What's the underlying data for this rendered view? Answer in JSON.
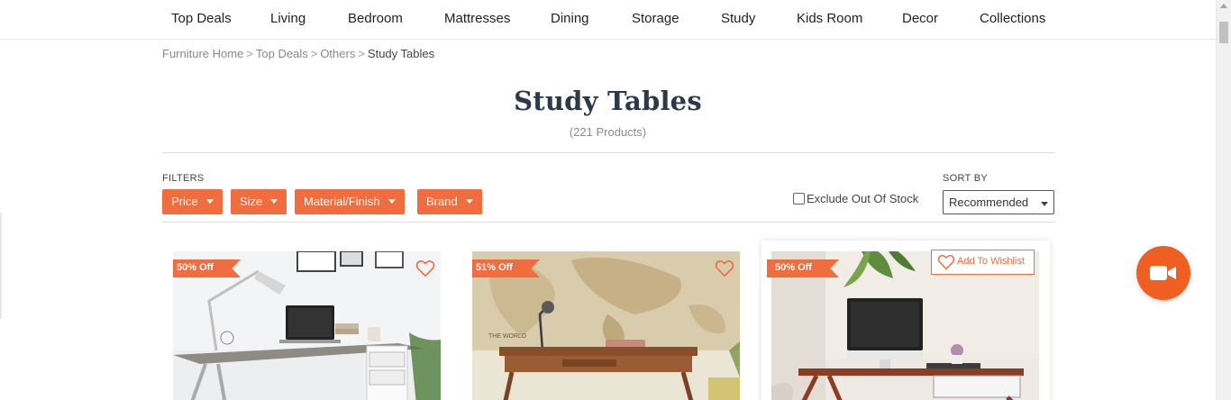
{
  "nav": {
    "items": [
      "Top Deals",
      "Living",
      "Bedroom",
      "Mattresses",
      "Dining",
      "Storage",
      "Study",
      "Kids Room",
      "Decor",
      "Collections"
    ]
  },
  "breadcrumb": {
    "items": [
      "Furniture Home",
      "Top Deals",
      "Others"
    ],
    "separator": ">",
    "current": "Study Tables"
  },
  "page": {
    "title": "Study Tables",
    "count": "(221 Products)"
  },
  "filters": {
    "label": "FILTERS",
    "buttons": [
      "Price",
      "Size",
      "Material/Finish",
      "Brand"
    ],
    "exclude_label": "Exclude Out Of Stock",
    "exclude_checked": false
  },
  "sort": {
    "label": "SORT BY",
    "selected": "Recommended"
  },
  "products": [
    {
      "discount": "50% Off",
      "wishlist_icon": "heart-outline-icon"
    },
    {
      "discount": "51% Off",
      "wishlist_icon": "heart-outline-icon"
    },
    {
      "discount": "50% Off",
      "wishlist_label": "Add To Wishlist",
      "wishlist_icon": "heart-outline-icon"
    }
  ],
  "colors": {
    "accent": "#ef6d3f",
    "title": "#2b3a4a",
    "video_button": "#ef5f21"
  },
  "video_button": {
    "icon": "video-camera-icon"
  }
}
